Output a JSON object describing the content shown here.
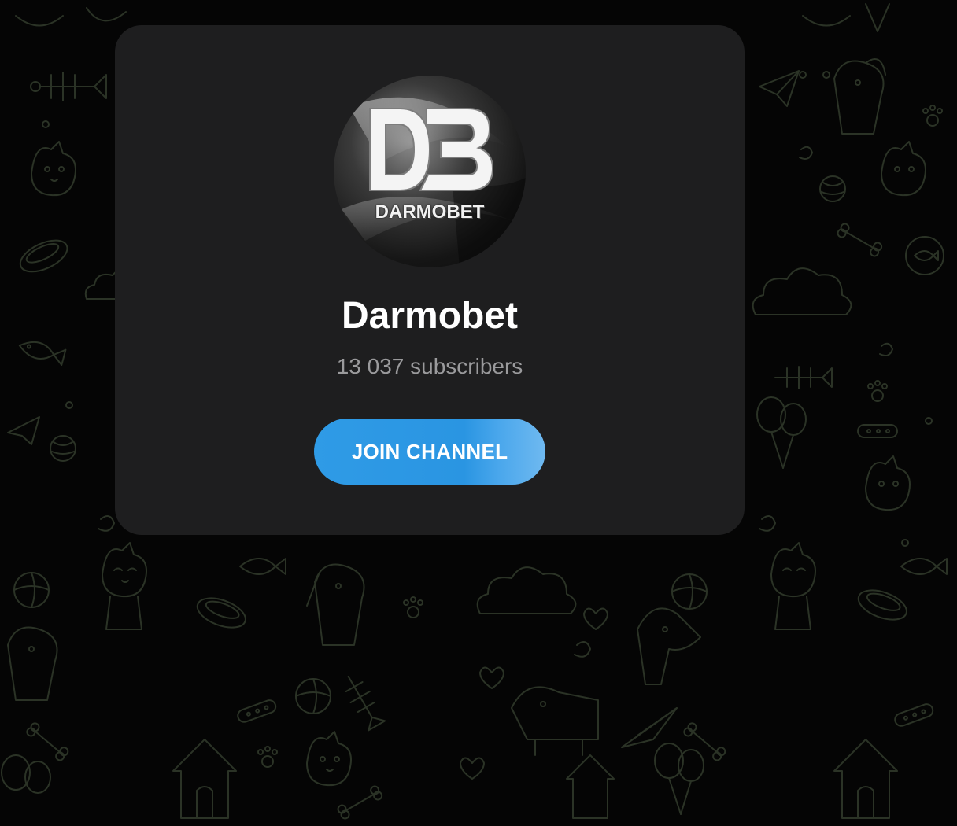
{
  "channel": {
    "name": "Darmobet",
    "subscribers": "13 037 subscribers",
    "avatar_monogram": "DB",
    "avatar_wordmark": "DARMOBET"
  },
  "actions": {
    "join_label": "JOIN CHANNEL"
  },
  "colors": {
    "background": "#050505",
    "card": "#1e1e1f",
    "doodle_stroke": "#2b3326",
    "button": "#2a95e2",
    "title": "#ffffff",
    "subtitle": "#9a9a9c"
  },
  "background_pattern": {
    "icons": [
      "cat-doodle-icon",
      "dog-doodle-icon",
      "fish-bone-doodle-icon",
      "paper-plane-doodle-icon",
      "balloon-doodle-icon",
      "yarn-ball-doodle-icon",
      "paw-print-doodle-icon",
      "bone-doodle-icon",
      "cloud-doodle-icon",
      "dog-house-doodle-icon",
      "heart-doodle-icon",
      "beach-ball-doodle-icon"
    ]
  }
}
